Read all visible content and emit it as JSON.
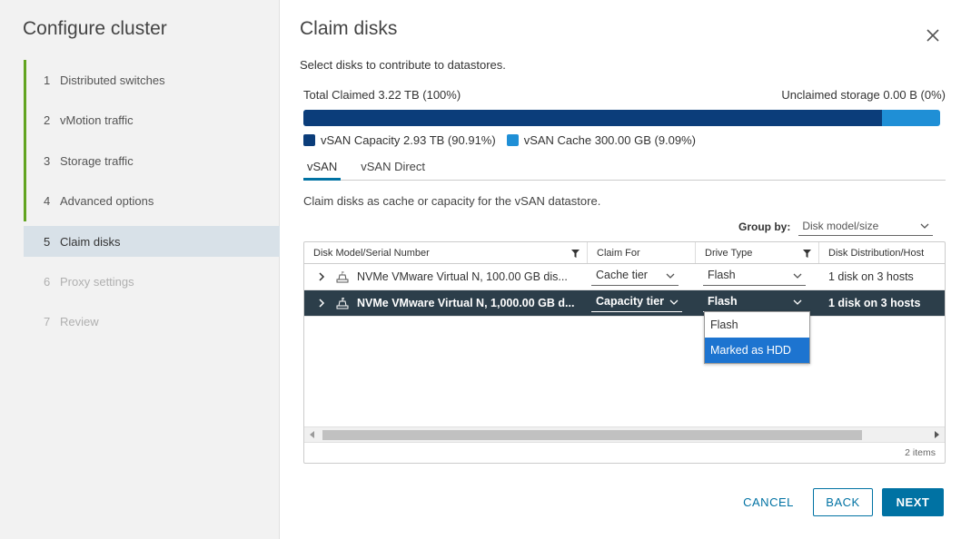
{
  "sidebar": {
    "title": "Configure cluster",
    "steps": [
      {
        "num": "1",
        "label": "Distributed switches",
        "state": "done"
      },
      {
        "num": "2",
        "label": "vMotion traffic",
        "state": "done"
      },
      {
        "num": "3",
        "label": "Storage traffic",
        "state": "done"
      },
      {
        "num": "4",
        "label": "Advanced options",
        "state": "done"
      },
      {
        "num": "5",
        "label": "Claim disks",
        "state": "active"
      },
      {
        "num": "6",
        "label": "Proxy settings",
        "state": "disabled"
      },
      {
        "num": "7",
        "label": "Review",
        "state": "disabled"
      }
    ]
  },
  "dialog": {
    "title": "Claim disks",
    "subtitle": "Select disks to contribute to datastores.",
    "close_icon": "close-icon"
  },
  "storage": {
    "total_claimed": "Total Claimed 3.22 TB (100%)",
    "unclaimed": "Unclaimed storage 0.00 B (0%)",
    "capacity_fraction": 0.9091,
    "legend": [
      {
        "label": "vSAN Capacity 2.93 TB (90.91%)",
        "color": "#0b3d7a"
      },
      {
        "label": "vSAN Cache 300.00 GB (9.09%)",
        "color": "#1f8fd6"
      }
    ]
  },
  "tabs": [
    {
      "label": "vSAN",
      "active": true
    },
    {
      "label": "vSAN Direct",
      "active": false
    }
  ],
  "description": "Claim disks as cache or capacity for the vSAN datastore.",
  "group_by": {
    "label": "Group by:",
    "value": "Disk model/size"
  },
  "grid": {
    "columns": [
      "Disk Model/Serial Number",
      "Claim For",
      "Drive Type",
      "Disk Distribution/Host"
    ],
    "rows": [
      {
        "model": "NVMe VMware Virtual N, 100.00 GB dis...",
        "claim_for": "Cache tier",
        "drive_type": "Flash",
        "distribution": "1 disk on 3 hosts",
        "selected": false
      },
      {
        "model": "NVMe VMware Virtual N, 1,000.00 GB d...",
        "claim_for": "Capacity tier",
        "drive_type": "Flash",
        "distribution": "1 disk on 3 hosts",
        "selected": true
      }
    ],
    "footer": "2 items"
  },
  "drive_type_dropdown": {
    "options": [
      "Flash",
      "Marked as HDD"
    ],
    "highlighted": "Marked as HDD"
  },
  "buttons": {
    "cancel": "CANCEL",
    "back": "BACK",
    "next": "NEXT"
  }
}
